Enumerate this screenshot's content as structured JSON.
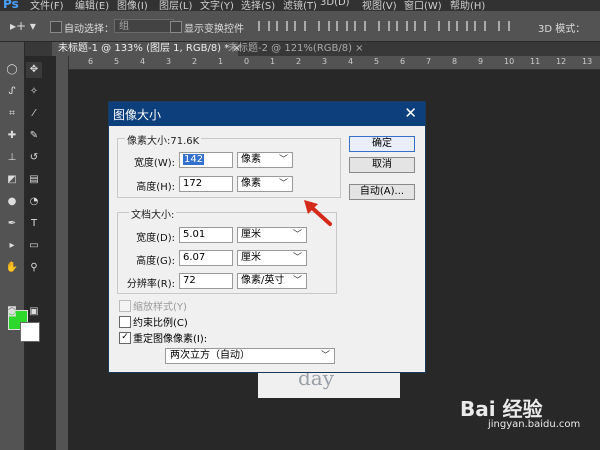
{
  "menubar": {
    "logo": "Ps",
    "items": [
      "文件(F)",
      "编辑(E)",
      "图像(I)",
      "图层(L)",
      "文字(Y)",
      "选择(S)",
      "滤镜(T)",
      "3D(D)",
      "视图(V)",
      "窗口(W)",
      "帮助(H)"
    ]
  },
  "options": {
    "tool_preset": "▸+ ▾",
    "auto_select_label": "自动选择：",
    "auto_select_value": "组",
    "show_transform_label": "显示变换控件",
    "mode_3d_label": "3D 模式："
  },
  "tabs": [
    {
      "label": "未标题-1 @ 133% (图层 1, RGB/8) *  ×"
    },
    {
      "label": "未标题-2 @ 121%(RGB/8)  ×"
    }
  ],
  "ruler": {
    "h_numbers": [
      "6",
      "5",
      "4",
      "3",
      "2",
      "1",
      "0",
      "1",
      "2",
      "3",
      "4",
      "5",
      "6",
      "7",
      "8",
      "9",
      "10",
      "11",
      "12",
      "13"
    ]
  },
  "document": {
    "visible_text": "day"
  },
  "dialog": {
    "title": "图像大小",
    "close": "✕",
    "pixel_group_title": "像素大小:71.6K",
    "width_label": "宽度(W):",
    "width_value": "142",
    "width_unit": "像素",
    "height_label": "高度(H):",
    "height_value": "172",
    "height_unit": "像素",
    "doc_group_title": "文档大小:",
    "doc_width_label": "宽度(D):",
    "doc_width_value": "5.01",
    "doc_width_unit": "厘米",
    "doc_height_label": "高度(G):",
    "doc_height_value": "6.07",
    "doc_height_unit": "厘米",
    "resolution_label": "分辨率(R):",
    "resolution_value": "72",
    "resolution_unit": "像素/英寸",
    "ok_label": "确定",
    "cancel_label": "取消",
    "auto_label": "自动(A)...",
    "scale_styles_label": "缩放样式(Y)",
    "constrain_label": "约束比例(C)",
    "resample_label": "重定图像像素(I):",
    "resample_value": "两次立方（自动）",
    "check_mark": "✓"
  },
  "watermark": {
    "brand": "Bai  经验",
    "url": "jingyan.baidu.com"
  },
  "colors": {
    "fg": "#2bd82b",
    "bg": "#ffffff",
    "title_bar": "#0c3f7c",
    "arrow": "#d42a1a"
  }
}
